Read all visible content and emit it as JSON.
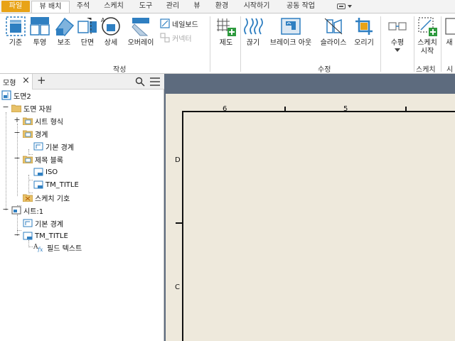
{
  "tabs": [
    "파일",
    "뷰 배치",
    "주석",
    "스케치",
    "도구",
    "관리",
    "뷰",
    "환경",
    "시작하기",
    "공동 작업"
  ],
  "ribbon": {
    "buttons": {
      "base": "기준",
      "projected": "투영",
      "auxiliary": "보조",
      "section": "단면",
      "detail": "상세",
      "overlay": "오버레이",
      "nailboard": "네일보드",
      "connector": "커넥터",
      "draft": "제도",
      "break": "끊기",
      "breakout": "브레이크 아웃",
      "slice": "슬라이스",
      "crop": "오리기",
      "horizontal": "수평",
      "start_sketch": "스케치\n시작",
      "new": "새"
    },
    "groups": {
      "create": "작성",
      "modify": "수정",
      "sketch": "스케치",
      "cut": "시"
    }
  },
  "browser": {
    "tab_label": "모형",
    "tree": {
      "root": "도면2",
      "drawing_resources": "도면 자원",
      "sheet_formats": "시트 형식",
      "borders": "경계",
      "default_border": "기본 경계",
      "title_blocks": "제목 블록",
      "iso": "ISO",
      "tm_title": "TM_TITLE",
      "sketched_symbols": "스케치 기호",
      "sheet1": "시트:1",
      "sheet_default_border": "기본 경계",
      "sheet_tm_title": "TM_TITLE",
      "field_text": "필드 텍스트"
    }
  },
  "canvas": {
    "zone_top": [
      "6",
      "5"
    ],
    "zone_left": [
      "D",
      "C"
    ]
  },
  "colors": {
    "file_tab": "#e8a317",
    "canvas_bg": "#5d6b7e",
    "sheet_bg": "#eee9dc",
    "icon_blue": "#2f7fc1",
    "icon_green": "#2e9a3e"
  }
}
